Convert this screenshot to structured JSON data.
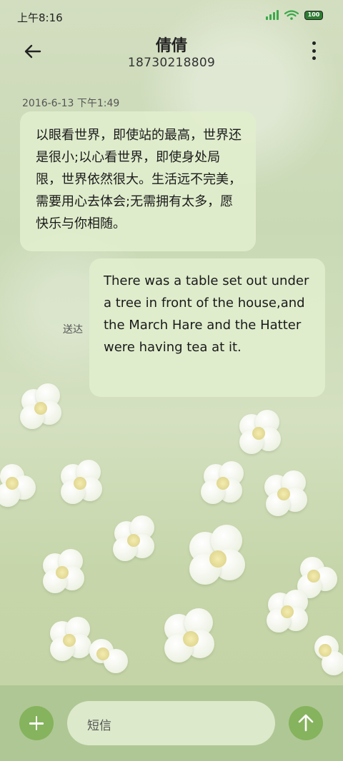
{
  "status": {
    "time": "上午8:16",
    "battery": "100"
  },
  "header": {
    "contact_name": "倩倩",
    "phone": "18730218809"
  },
  "messages": {
    "timestamp": "2016-6-13 下午1:49",
    "incoming_text": "以眼看世界，即使站的最高，世界还是很小;以心看世界，即使身处局限，世界依然很大。生活远不完美，需要用心去体会;无需拥有太多，愿快乐与你相随。",
    "outgoing_text": "There was a table set out under a tree in front of the house,and the March Hare and the Hatter were having tea at it.",
    "outgoing_status": "送达"
  },
  "composer": {
    "placeholder": "短信"
  },
  "colors": {
    "accent": "#86b35d",
    "bubble": "#e1eecd",
    "signal": "#3aa84a",
    "battery": "#2e7d32"
  },
  "icons": [
    "back-arrow-icon",
    "more-vertical-icon",
    "add-icon",
    "send-arrow-icon",
    "signal-icon",
    "wifi-icon",
    "battery-icon"
  ]
}
